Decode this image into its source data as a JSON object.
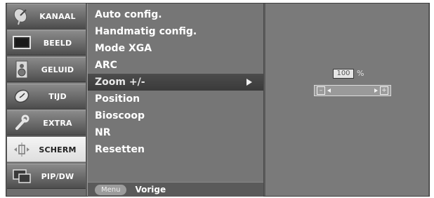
{
  "sidebar": {
    "items": [
      {
        "label": "KANAAL",
        "icon": "satellite-dish-icon"
      },
      {
        "label": "BEELD",
        "icon": "picture-monitor-icon"
      },
      {
        "label": "GELUID",
        "icon": "speaker-icon"
      },
      {
        "label": "TIJD",
        "icon": "clock-icon"
      },
      {
        "label": "EXTRA",
        "icon": "wrench-icon"
      },
      {
        "label": "SCHERM",
        "icon": "screen-adjust-icon",
        "active": true
      },
      {
        "label": "PIP/DW",
        "icon": "pip-icon"
      }
    ]
  },
  "menu": {
    "items": [
      {
        "label": "Auto config."
      },
      {
        "label": "Handmatig config."
      },
      {
        "label": "Mode XGA"
      },
      {
        "label": "ARC"
      },
      {
        "label": "Zoom +/-",
        "selected": true
      },
      {
        "label": "Position"
      },
      {
        "label": "Bioscoop"
      },
      {
        "label": "NR"
      },
      {
        "label": "Resetten"
      }
    ],
    "footer": {
      "menu_key": "Menu",
      "back_label": "Vorige"
    }
  },
  "zoom": {
    "value": "100",
    "unit": "%",
    "minus_symbol": "–",
    "plus_symbol": "+"
  },
  "colors": {
    "active_tab": "#e6e6e6",
    "selected_row": "#404040",
    "panel_bg": "#767676"
  }
}
